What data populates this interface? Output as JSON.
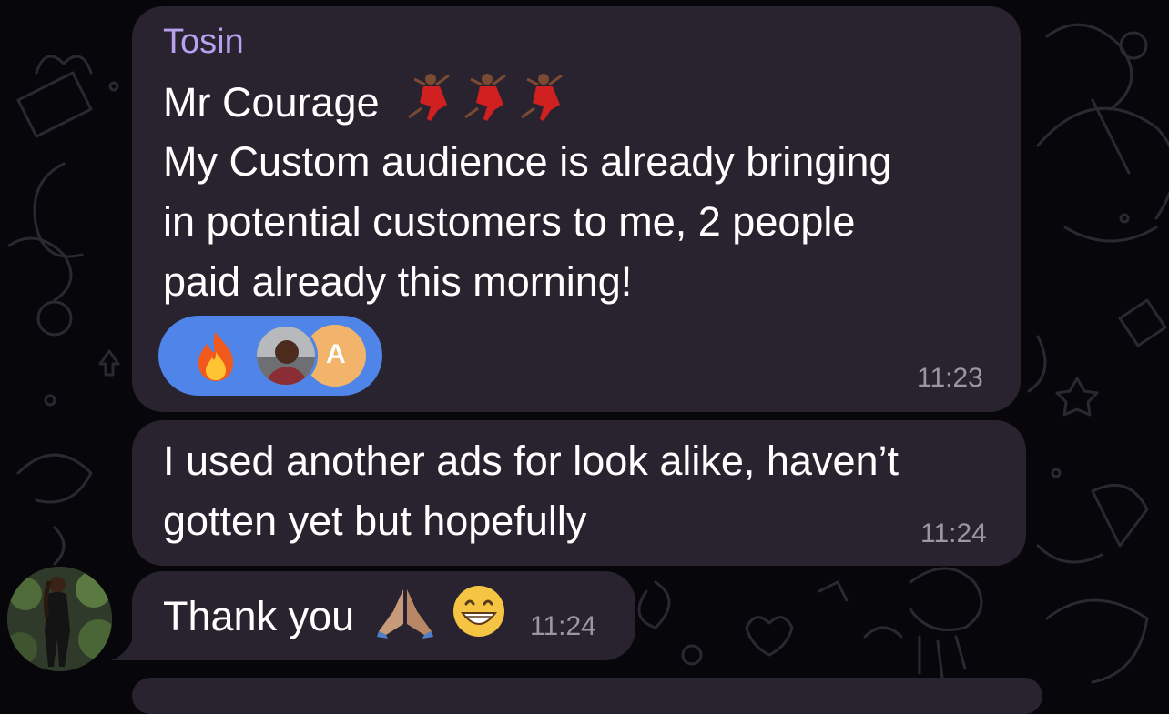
{
  "messages": [
    {
      "sender": "Tosin",
      "lines": [
        "Mr Courage",
        "My Custom audience is already bringing",
        "in potential customers to me, 2 people",
        "paid already this morning!"
      ],
      "time": "11:23",
      "reaction": {
        "emoji": "fire",
        "avatar_initial": "A"
      }
    },
    {
      "lines": [
        "I used another ads for look alike, haven’t",
        "gotten yet but hopefully"
      ],
      "time": "11:24"
    },
    {
      "lines": [
        "Thank you"
      ],
      "time": "11:24"
    }
  ],
  "colors": {
    "background": "#07060b",
    "bubble": "#28232f",
    "sender_name": "#b9a0ee",
    "reaction_pill": "#4f85e8",
    "timestamp": "#9b97a1"
  },
  "icons": [
    "dancer-icon",
    "fire-icon",
    "folded-hands-icon",
    "grinning-face-icon"
  ]
}
